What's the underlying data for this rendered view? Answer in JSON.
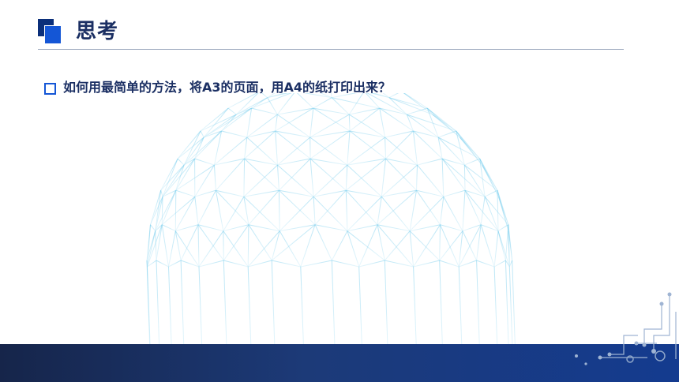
{
  "slide": {
    "title": "思考",
    "question": "如何用最简单的方法，将A3的页面，用A4的纸打印出来？"
  },
  "icons": {
    "title": "title-squares-icon",
    "bullet": "hollow-square-bullet-icon",
    "decoration": "geodesic-globe",
    "corner": "circuit-decoration"
  },
  "colors": {
    "title_text": "#1b2f63",
    "accent": "#1456d6",
    "footer": "#1c3a78"
  }
}
